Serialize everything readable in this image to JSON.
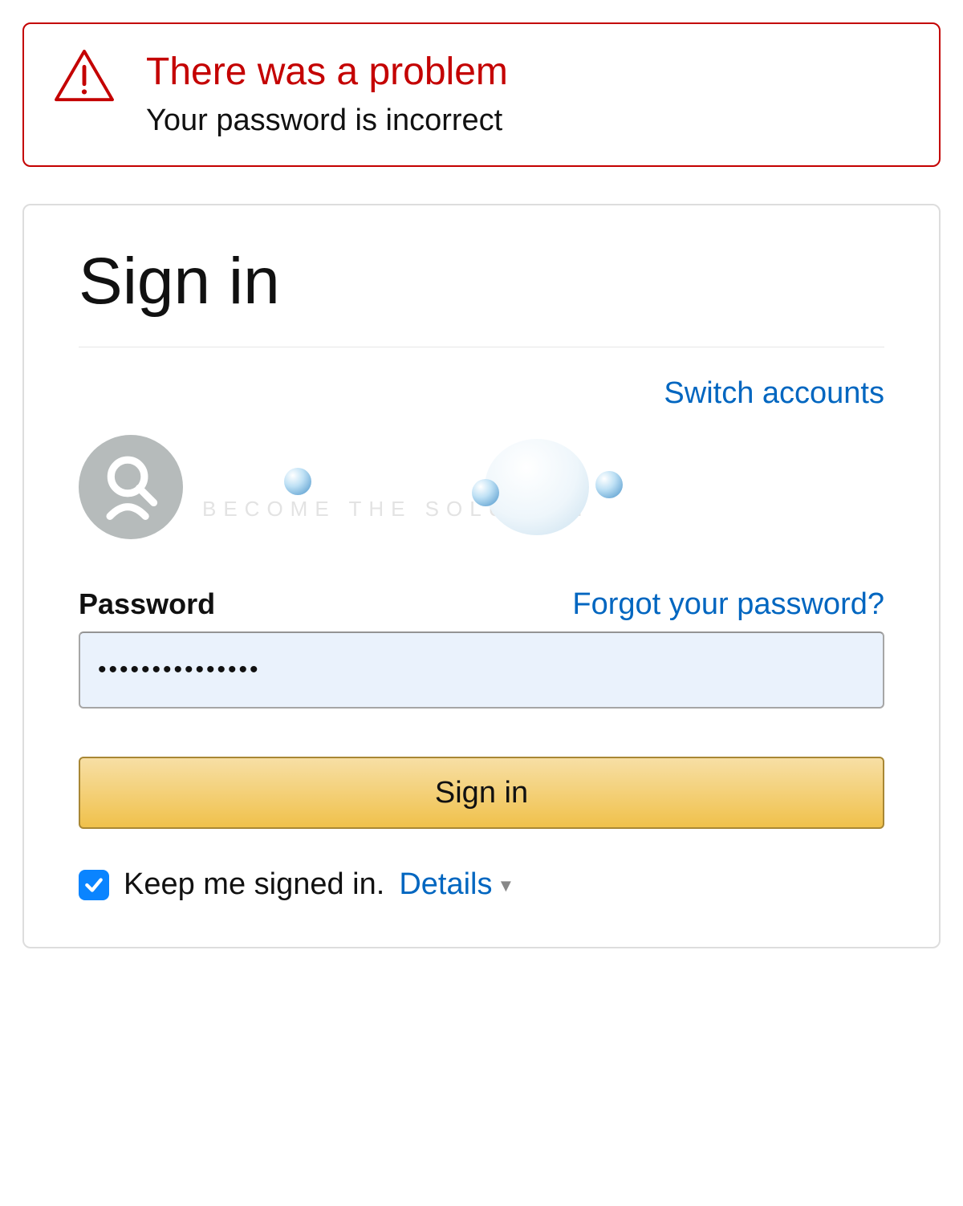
{
  "alert": {
    "title": "There was a problem",
    "message": "Your password is incorrect"
  },
  "signin": {
    "heading": "Sign in",
    "switch_accounts": "Switch accounts",
    "password_label": "Password",
    "forgot_link": "Forgot your password?",
    "password_value": "•••••••••••••••",
    "button_label": "Sign in",
    "keep_signed_label": "Keep me signed in.",
    "details_link": "Details",
    "keep_signed_checked": true,
    "watermark_text": "BECOME THE SOLUTION"
  }
}
